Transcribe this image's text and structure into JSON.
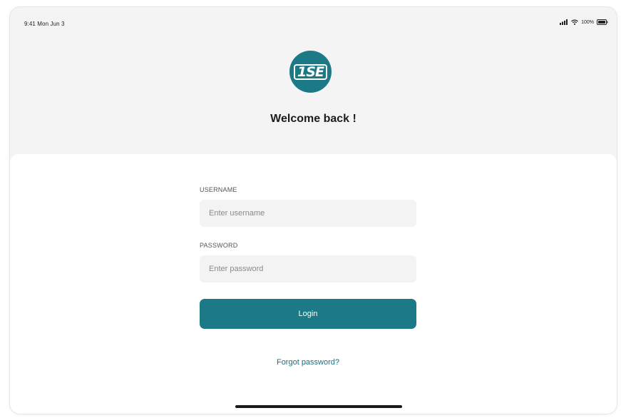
{
  "status_bar": {
    "time": "9:41 Mon Jun 3",
    "battery": "100%",
    "icons": [
      "signal-icon",
      "wifi-icon",
      "battery-icon"
    ]
  },
  "logo": {
    "text": "1SE",
    "color": "#1c7a86"
  },
  "header": {
    "welcome": "Welcome back !"
  },
  "form": {
    "username_label": "USERNAME",
    "username_placeholder": "Enter username",
    "username_value": "",
    "password_label": "PASSWORD",
    "password_placeholder": "Enter password",
    "password_value": "",
    "login_label": "Login",
    "forgot_label": "Forgot password?"
  },
  "colors": {
    "accent": "#1c7a86",
    "background_top": "#f4f4f4",
    "card": "#ffffff",
    "input_bg": "#f3f3f3"
  }
}
